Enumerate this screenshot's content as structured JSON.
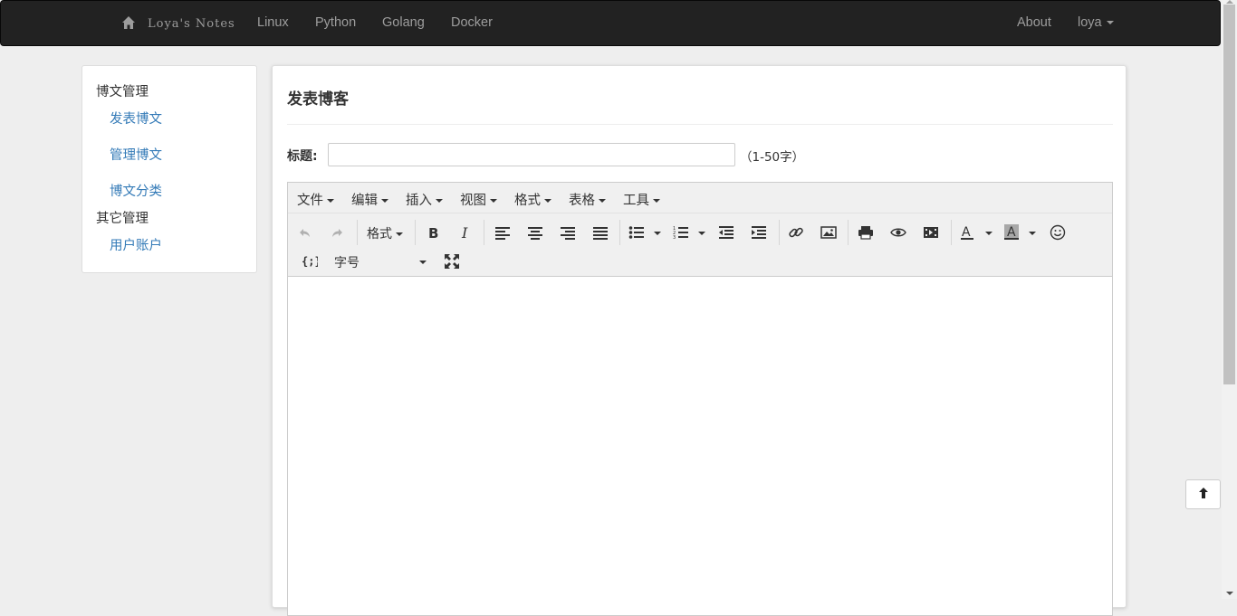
{
  "navbar": {
    "brand": "Loya's Notes",
    "links": [
      "Linux",
      "Python",
      "Golang",
      "Docker"
    ],
    "about": "About",
    "user": "loya",
    "home_icon": "home-icon"
  },
  "sidebar": {
    "sections": [
      {
        "heading": "博文管理",
        "items": [
          "发表博文",
          "管理博文",
          "博文分类"
        ]
      },
      {
        "heading": "其它管理",
        "items": [
          "用户账户"
        ]
      }
    ]
  },
  "main": {
    "page_title": "发表博客",
    "title_label": "标题:",
    "title_value": "",
    "title_hint": "（1-50字）"
  },
  "editor": {
    "menus": [
      "文件",
      "编辑",
      "插入",
      "视图",
      "格式",
      "表格",
      "工具"
    ],
    "format_dropdown": "格式",
    "fontsize_dropdown": "字号",
    "tool_icons": [
      "undo-icon",
      "redo-icon",
      "bold-icon",
      "italic-icon",
      "align-left-icon",
      "align-center-icon",
      "align-right-icon",
      "align-justify-icon",
      "bullet-list-icon",
      "numbered-list-icon",
      "outdent-icon",
      "indent-icon",
      "link-icon",
      "image-icon",
      "print-icon",
      "preview-icon",
      "media-icon",
      "text-color-icon",
      "background-color-icon",
      "emoticons-icon",
      "code-icon",
      "fullscreen-icon"
    ]
  },
  "colors": {
    "navbar_bg": "#222222",
    "nav_text": "#9d9d9d",
    "link": "#337ab7",
    "page_bg": "#eeeeee"
  }
}
